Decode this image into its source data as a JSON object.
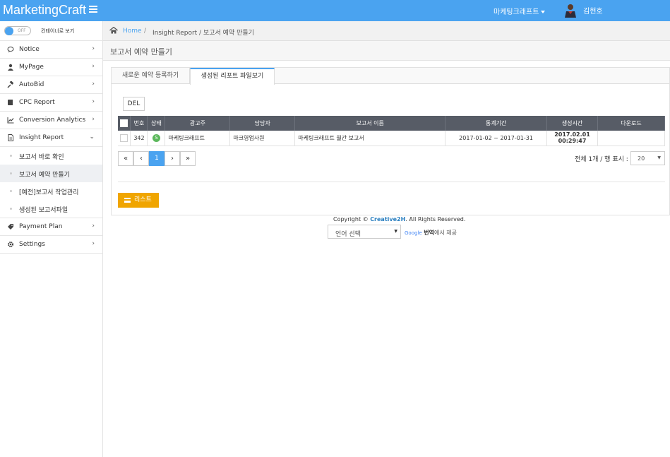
{
  "header": {
    "brand": "MarketingCraft",
    "company": "마케팅크래프트",
    "username": "김현호"
  },
  "sidebar": {
    "toggle_state": "OFF",
    "toggle_label": "컨테이너로 보기",
    "items": [
      {
        "label": "Notice",
        "icon": "comment-icon"
      },
      {
        "label": "MyPage",
        "icon": "user-icon"
      },
      {
        "label": "AutoBid",
        "icon": "gavel-icon"
      },
      {
        "label": "CPC Report",
        "icon": "book-icon"
      },
      {
        "label": "Conversion Analytics",
        "icon": "chart-line-icon"
      },
      {
        "label": "Insight Report",
        "icon": "file-icon"
      },
      {
        "label": "Payment Plan",
        "icon": "tag-icon"
      },
      {
        "label": "Settings",
        "icon": "gear-icon"
      }
    ],
    "insight_sub": [
      {
        "label": "보고서 바로 확인"
      },
      {
        "label": "보고서 예약 만들기"
      },
      {
        "label": "[예전]보고서 작업관리"
      },
      {
        "label": "생성된 보고서파일"
      }
    ]
  },
  "breadcrumb": {
    "home": "Home",
    "separator": "/",
    "path": "Insight Report / 보고서 예약 만들기"
  },
  "page_title": "보고서 예약 만들기",
  "tabs": {
    "tab1": "새로운 예약 등록하기",
    "tab2": "생성된 리포트 파일보기"
  },
  "toolbar": {
    "del_label": "DEL"
  },
  "table": {
    "headers": [
      "번호",
      "상태",
      "광고주",
      "담당자",
      "보고서 이름",
      "통계기간",
      "생성시간",
      "다운로드"
    ],
    "rows": [
      {
        "no": "342",
        "status": "S",
        "advertiser": "마케팅크래프트",
        "manager": "마크영업사원",
        "report_name": "마케팅크래프트 월간 보고서",
        "period": "2017-01-02 ~ 2017-01-31",
        "created": "2017.02.01 00:29:47",
        "download": ""
      }
    ]
  },
  "pagination": {
    "first": "«",
    "prev": "‹",
    "current": "1",
    "next": "›",
    "last": "»"
  },
  "summary": "전체 1개 / 행 표시 :",
  "per_page": "20",
  "list_button": "리스트",
  "footer": {
    "copyright": "Copyright ©",
    "company": "Creative2H",
    "rights": ". All Rights Reserved.",
    "lang_select": "언어 선택",
    "google": "Google",
    "translate": "번역",
    "provided": "에서 제공"
  },
  "colors": {
    "topbar": "#4aa3f0",
    "table_header": "#575c66",
    "list_button": "#f0a500",
    "status_green": "#5cb85c"
  }
}
